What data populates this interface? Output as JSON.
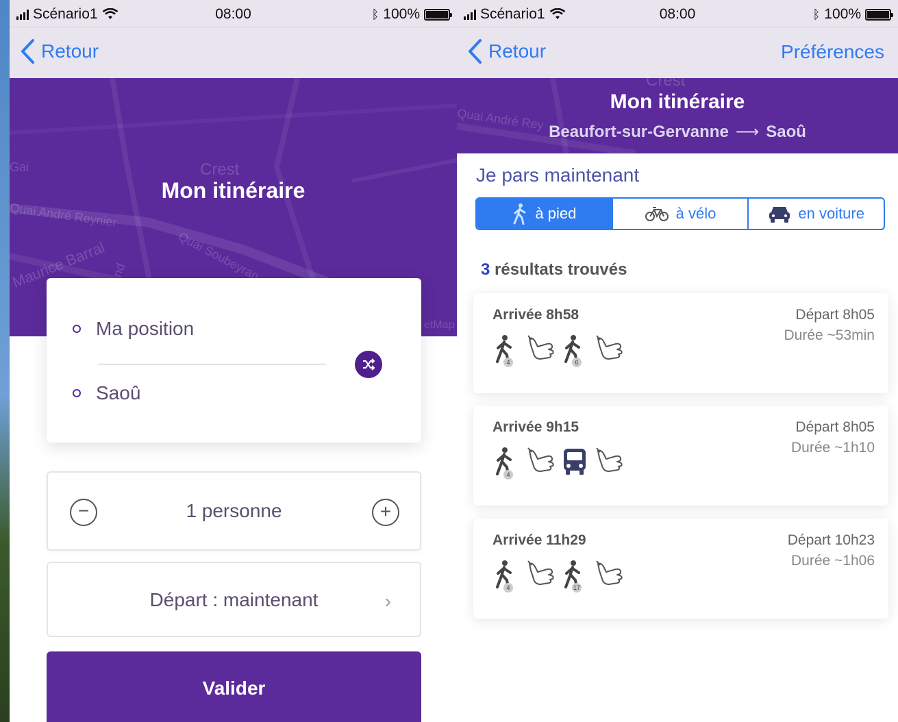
{
  "status": {
    "carrier": "Scénario1",
    "time": "08:00",
    "battery": "100%"
  },
  "left": {
    "nav": {
      "back": "Retour"
    },
    "map": {
      "title": "Mon itinéraire",
      "labels": [
        "Crest",
        "Gai",
        "Quai André Reynier",
        "Maurice Barral",
        "Quai Soubeyran",
        "nd",
        "etMap"
      ]
    },
    "from": "Ma position",
    "to": "Saoû",
    "passengers": "1 personne",
    "departure": "Départ : maintenant",
    "validate": "Valider"
  },
  "right": {
    "nav": {
      "back": "Retour",
      "prefs": "Préférences"
    },
    "map": {
      "title": "Mon itinéraire",
      "from": "Beaufort-sur-Gervanne",
      "to": "Saoû",
      "labels": [
        "Crest",
        "Quai André Rey"
      ]
    },
    "now": "Je pars maintenant",
    "modes": [
      {
        "label": "à pied",
        "icon": "walk-icon",
        "active": true
      },
      {
        "label": "à vélo",
        "icon": "bike-icon",
        "active": false
      },
      {
        "label": "en voiture",
        "icon": "car-icon",
        "active": false
      }
    ],
    "results_count": "3",
    "results_label": "résultats trouvés",
    "results": [
      {
        "arrival": "Arrivée 8h58",
        "departure": "Départ 8h05",
        "duration": "Durée ~53min",
        "legs": [
          {
            "type": "walk",
            "badge": "4"
          },
          {
            "type": "hitch"
          },
          {
            "type": "walk",
            "badge": "6"
          },
          {
            "type": "hitch"
          }
        ]
      },
      {
        "arrival": "Arrivée 9h15",
        "departure": "Départ 8h05",
        "duration": "Durée ~1h10",
        "legs": [
          {
            "type": "walk",
            "badge": "4"
          },
          {
            "type": "hitch"
          },
          {
            "type": "bus"
          },
          {
            "type": "hitch"
          }
        ]
      },
      {
        "arrival": "Arrivée 11h29",
        "departure": "Départ 10h23",
        "duration": "Durée ~1h06",
        "legs": [
          {
            "type": "walk",
            "badge": "4"
          },
          {
            "type": "hitch"
          },
          {
            "type": "walk",
            "badge": "17"
          },
          {
            "type": "hitch"
          }
        ]
      }
    ]
  },
  "colors": {
    "brand": "#5b2a9b",
    "link": "#2f7bf0",
    "navbar": "#e9e5ef"
  }
}
